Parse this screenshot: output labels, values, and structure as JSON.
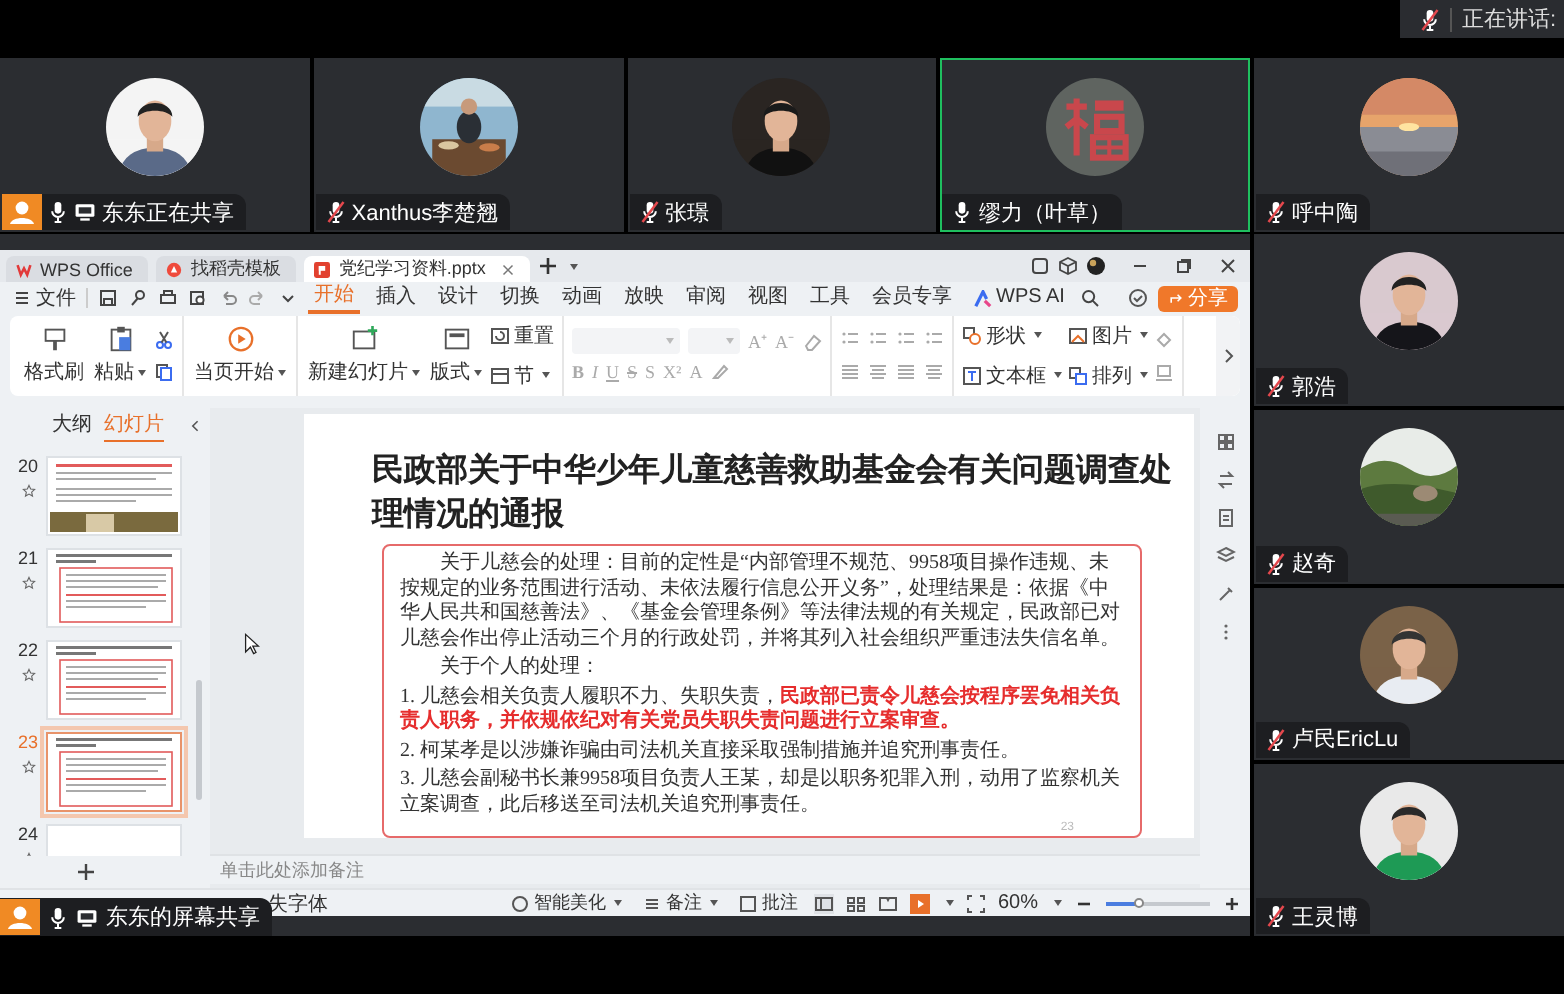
{
  "speaking_indicator": {
    "label": "正在讲话:",
    "muted": true
  },
  "participants": [
    {
      "name": "东东正在共享",
      "muted": false,
      "sharing": true,
      "active_speaker": false
    },
    {
      "name": "Xanthus李楚翘",
      "muted": true,
      "sharing": false,
      "active_speaker": false
    },
    {
      "name": "张璟",
      "muted": true,
      "sharing": false,
      "active_speaker": false
    },
    {
      "name": "缪力（叶草）",
      "muted": false,
      "sharing": false,
      "active_speaker": true
    },
    {
      "name": "呼中陶",
      "muted": true,
      "sharing": false,
      "active_speaker": false
    },
    {
      "name": "郭浩",
      "muted": true,
      "sharing": false,
      "active_speaker": false
    },
    {
      "name": "赵奇",
      "muted": true,
      "sharing": false,
      "active_speaker": false
    },
    {
      "name": "卢民EricLu",
      "muted": true,
      "sharing": false,
      "active_speaker": false
    },
    {
      "name": "王灵博",
      "muted": true,
      "sharing": false,
      "active_speaker": false
    }
  ],
  "screen_share": {
    "label": "东东的屏幕共享",
    "muted": false,
    "app": {
      "tabs": [
        {
          "label": "WPS Office",
          "kind": "home",
          "selected": false
        },
        {
          "label": "找稻壳模板",
          "kind": "template",
          "selected": false
        },
        {
          "label": "党纪学习资料.pptx",
          "kind": "file",
          "selected": true
        }
      ],
      "menu": {
        "file_label": "文件",
        "share_button": "分享",
        "tabs": [
          {
            "label": "开始",
            "kind": "tab",
            "selected": true
          },
          {
            "label": "插入",
            "kind": "tab",
            "selected": false
          },
          {
            "label": "设计",
            "kind": "tab",
            "selected": false
          },
          {
            "label": "切换",
            "kind": "tab",
            "selected": false
          },
          {
            "label": "动画",
            "kind": "tab",
            "selected": false
          },
          {
            "label": "放映",
            "kind": "tab",
            "selected": false
          },
          {
            "label": "审阅",
            "kind": "tab",
            "selected": false
          },
          {
            "label": "视图",
            "kind": "tab",
            "selected": false
          },
          {
            "label": "工具",
            "kind": "tab",
            "selected": false
          },
          {
            "label": "会员专享",
            "kind": "tab",
            "selected": false
          },
          {
            "label": "WPS AI",
            "kind": "ai",
            "selected": false
          }
        ]
      },
      "ribbon": {
        "format_painter": "格式刷",
        "paste": "粘贴",
        "start_from_current": "当页开始",
        "new_slide": "新建幻灯片",
        "layout": "版式",
        "reset": "重置",
        "section": "节",
        "font_size_buttons": [
          "A⁺",
          "A⁻"
        ],
        "font_buttons": [
          "B",
          "I",
          "U",
          "S",
          "S",
          "X²",
          "A"
        ],
        "shape": "形状",
        "picture": "图片",
        "text_box": "文本框",
        "arrange": "排列"
      },
      "side_panel": {
        "tabs": [
          {
            "label": "大纲",
            "selected": false
          },
          {
            "label": "幻灯片",
            "selected": true
          }
        ],
        "slides": [
          {
            "number": "20",
            "selected": false
          },
          {
            "number": "21",
            "kind": "boxed",
            "selected": false
          },
          {
            "number": "22",
            "kind": "boxed",
            "selected": false
          },
          {
            "number": "23",
            "kind": "boxed",
            "selected": true
          },
          {
            "number": "24",
            "kind": "blank",
            "selected": false
          }
        ]
      },
      "slide": {
        "title": "民政部关于中华少年儿童慈善救助基金会有关问题调查处理情况的通报",
        "page_number": "23",
        "paragraphs": [
          {
            "kind": "body",
            "text": "关于儿慈会的处理：目前的定性是“内部管理不规范、9958项目操作违规、未按规定的业务范围进行活动、未依法履行信息公开义务”，处理结果是：依据《中华人民共和国慈善法》、《基金会管理条例》等法律法规的有关规定，民政部已对儿慈会作出停止活动三个月的行政处罚，并将其列入社会组织严重违法失信名单。"
          },
          {
            "kind": "body",
            "text": "关于个人的处理："
          },
          {
            "kind": "list",
            "text": "1. 儿慈会相关负责人履职不力、失职失责，**民政部已责令儿慈会按程序罢免相关负责人职务，并依规依纪对有关党员失职失责问题进行立案审查。**"
          },
          {
            "kind": "list",
            "text": "2. 柯某孝是以涉嫌诈骗由司法机关直接采取强制措施并追究刑事责任。"
          },
          {
            "kind": "list",
            "text": "3. 儿慈会副秘书长兼9958项目负责人王某，却是以职务犯罪入刑，动用了监察机关立案调查，此后移送至司法机关追究刑事责任。"
          }
        ]
      },
      "notes": {
        "placeholder": "单击此处添加备注"
      },
      "status_bar": {
        "missing_font": "失字体",
        "smart_beautify": "智能美化",
        "notes": "备注",
        "comments": "批注",
        "zoom": "60%",
        "zoom_slider": {
          "level": 0.3
        }
      }
    }
  }
}
